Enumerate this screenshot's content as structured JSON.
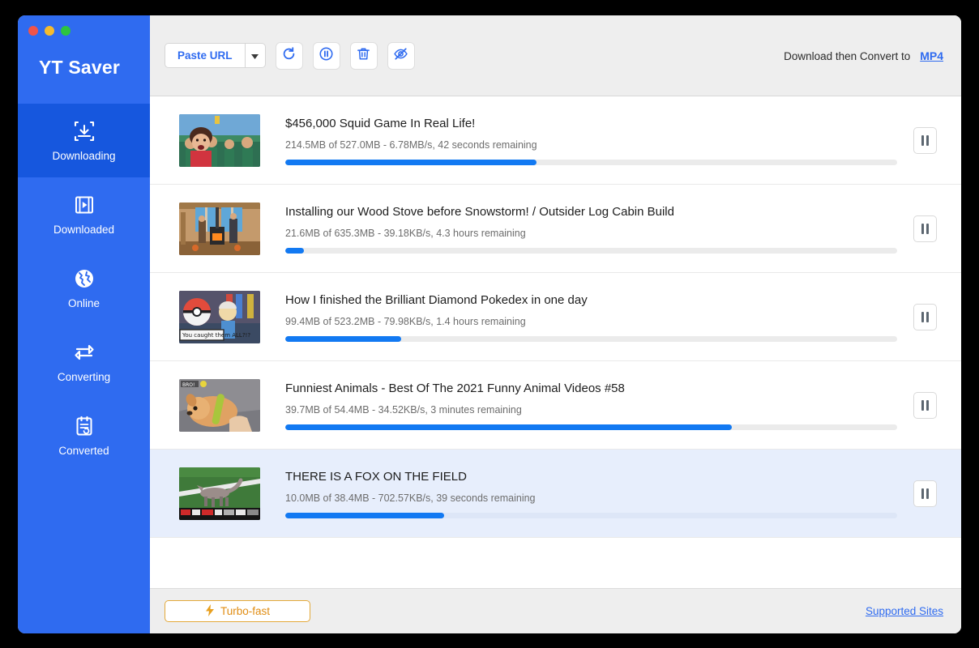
{
  "window": {
    "traffic_lights": [
      "close",
      "minimize",
      "maximize"
    ],
    "brand": "YT Saver"
  },
  "sidebar": {
    "items": [
      {
        "label": "Downloading",
        "icon": "download-box-icon",
        "active": true
      },
      {
        "label": "Downloaded",
        "icon": "film-play-icon",
        "active": false
      },
      {
        "label": "Online",
        "icon": "globe-icon",
        "active": false
      },
      {
        "label": "Converting",
        "icon": "convert-loop-icon",
        "active": false
      },
      {
        "label": "Converted",
        "icon": "clipboard-refresh-icon",
        "active": false
      }
    ]
  },
  "toolbar": {
    "paste_url_label": "Paste URL",
    "dropdown_icon": "chevron-down-icon",
    "buttons": [
      {
        "name": "refresh-button",
        "icon": "refresh-icon"
      },
      {
        "name": "pause-all-button",
        "icon": "pause-circle-icon"
      },
      {
        "name": "delete-button",
        "icon": "trash-icon"
      },
      {
        "name": "hide-button",
        "icon": "eye-slash-icon"
      }
    ],
    "convert_label": "Download then Convert to",
    "convert_format": "MP4"
  },
  "downloads": [
    {
      "title": "$456,000 Squid Game In Real Life!",
      "status": "214.5MB of 527.0MB -  6.78MB/s, 42 seconds remaining",
      "progress": 41,
      "selected": false,
      "thumb": "squid-game-thumbnail",
      "action_icon": "pause-icon"
    },
    {
      "title": "Installing our Wood Stove before Snowstorm! / Outsider Log Cabin Build",
      "status": "21.6MB of 635.3MB - 39.18KB/s, 4.3 hours remaining",
      "progress": 3,
      "selected": false,
      "thumb": "wood-stove-thumbnail",
      "action_icon": "pause-icon"
    },
    {
      "title": "How I finished the Brilliant Diamond Pokedex in one day",
      "status": "99.4MB of 523.2MB - 79.98KB/s, 1.4 hours remaining",
      "progress": 19,
      "selected": false,
      "thumb": "pokedex-thumbnail",
      "action_icon": "pause-icon"
    },
    {
      "title": "Funniest Animals - Best Of The 2021 Funny Animal Videos #58",
      "status": "39.7MB of 54.4MB - 34.52KB/s, 3 minutes remaining",
      "progress": 73,
      "selected": false,
      "thumb": "funny-animals-thumbnail",
      "action_icon": "pause-icon"
    },
    {
      "title": "THERE IS A FOX ON THE FIELD",
      "status": "10.0MB of 38.4MB - 702.57KB/s, 39 seconds remaining",
      "progress": 26,
      "selected": true,
      "thumb": "fox-field-thumbnail",
      "action_icon": "pause-icon"
    }
  ],
  "footer": {
    "turbo_label": "Turbo-fast",
    "turbo_icon": "lightning-bolt-icon",
    "supported_sites_label": "Supported Sites"
  },
  "colors": {
    "sidebar_blue": "#2f6bf0",
    "sidebar_active_blue": "#1657de",
    "accent_blue": "#2f6bf0",
    "progress_blue": "#1279f2",
    "selected_row": "#e7eefc",
    "turbo_orange": "#e08c12"
  }
}
